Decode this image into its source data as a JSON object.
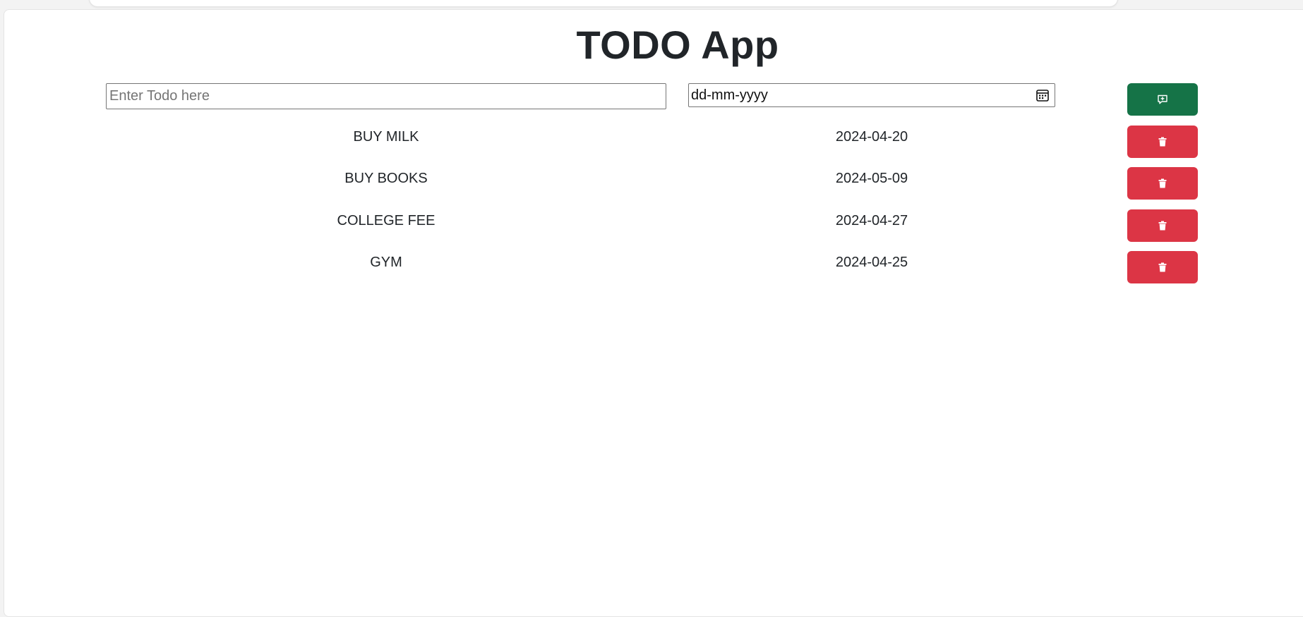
{
  "app": {
    "title": "TODO App"
  },
  "form": {
    "todo_placeholder": "Enter Todo here",
    "date_placeholder": "dd-mm-yyyy",
    "add_icon": "add-comment-icon"
  },
  "todos": [
    {
      "name": "BUY MILK",
      "date": "2024-04-20"
    },
    {
      "name": "BUY BOOKS",
      "date": "2024-05-09"
    },
    {
      "name": "COLLEGE FEE",
      "date": "2024-04-27"
    },
    {
      "name": "GYM",
      "date": "2024-04-25"
    }
  ],
  "colors": {
    "add_button": "#157347",
    "delete_button": "#dc3545",
    "text": "#212529"
  }
}
